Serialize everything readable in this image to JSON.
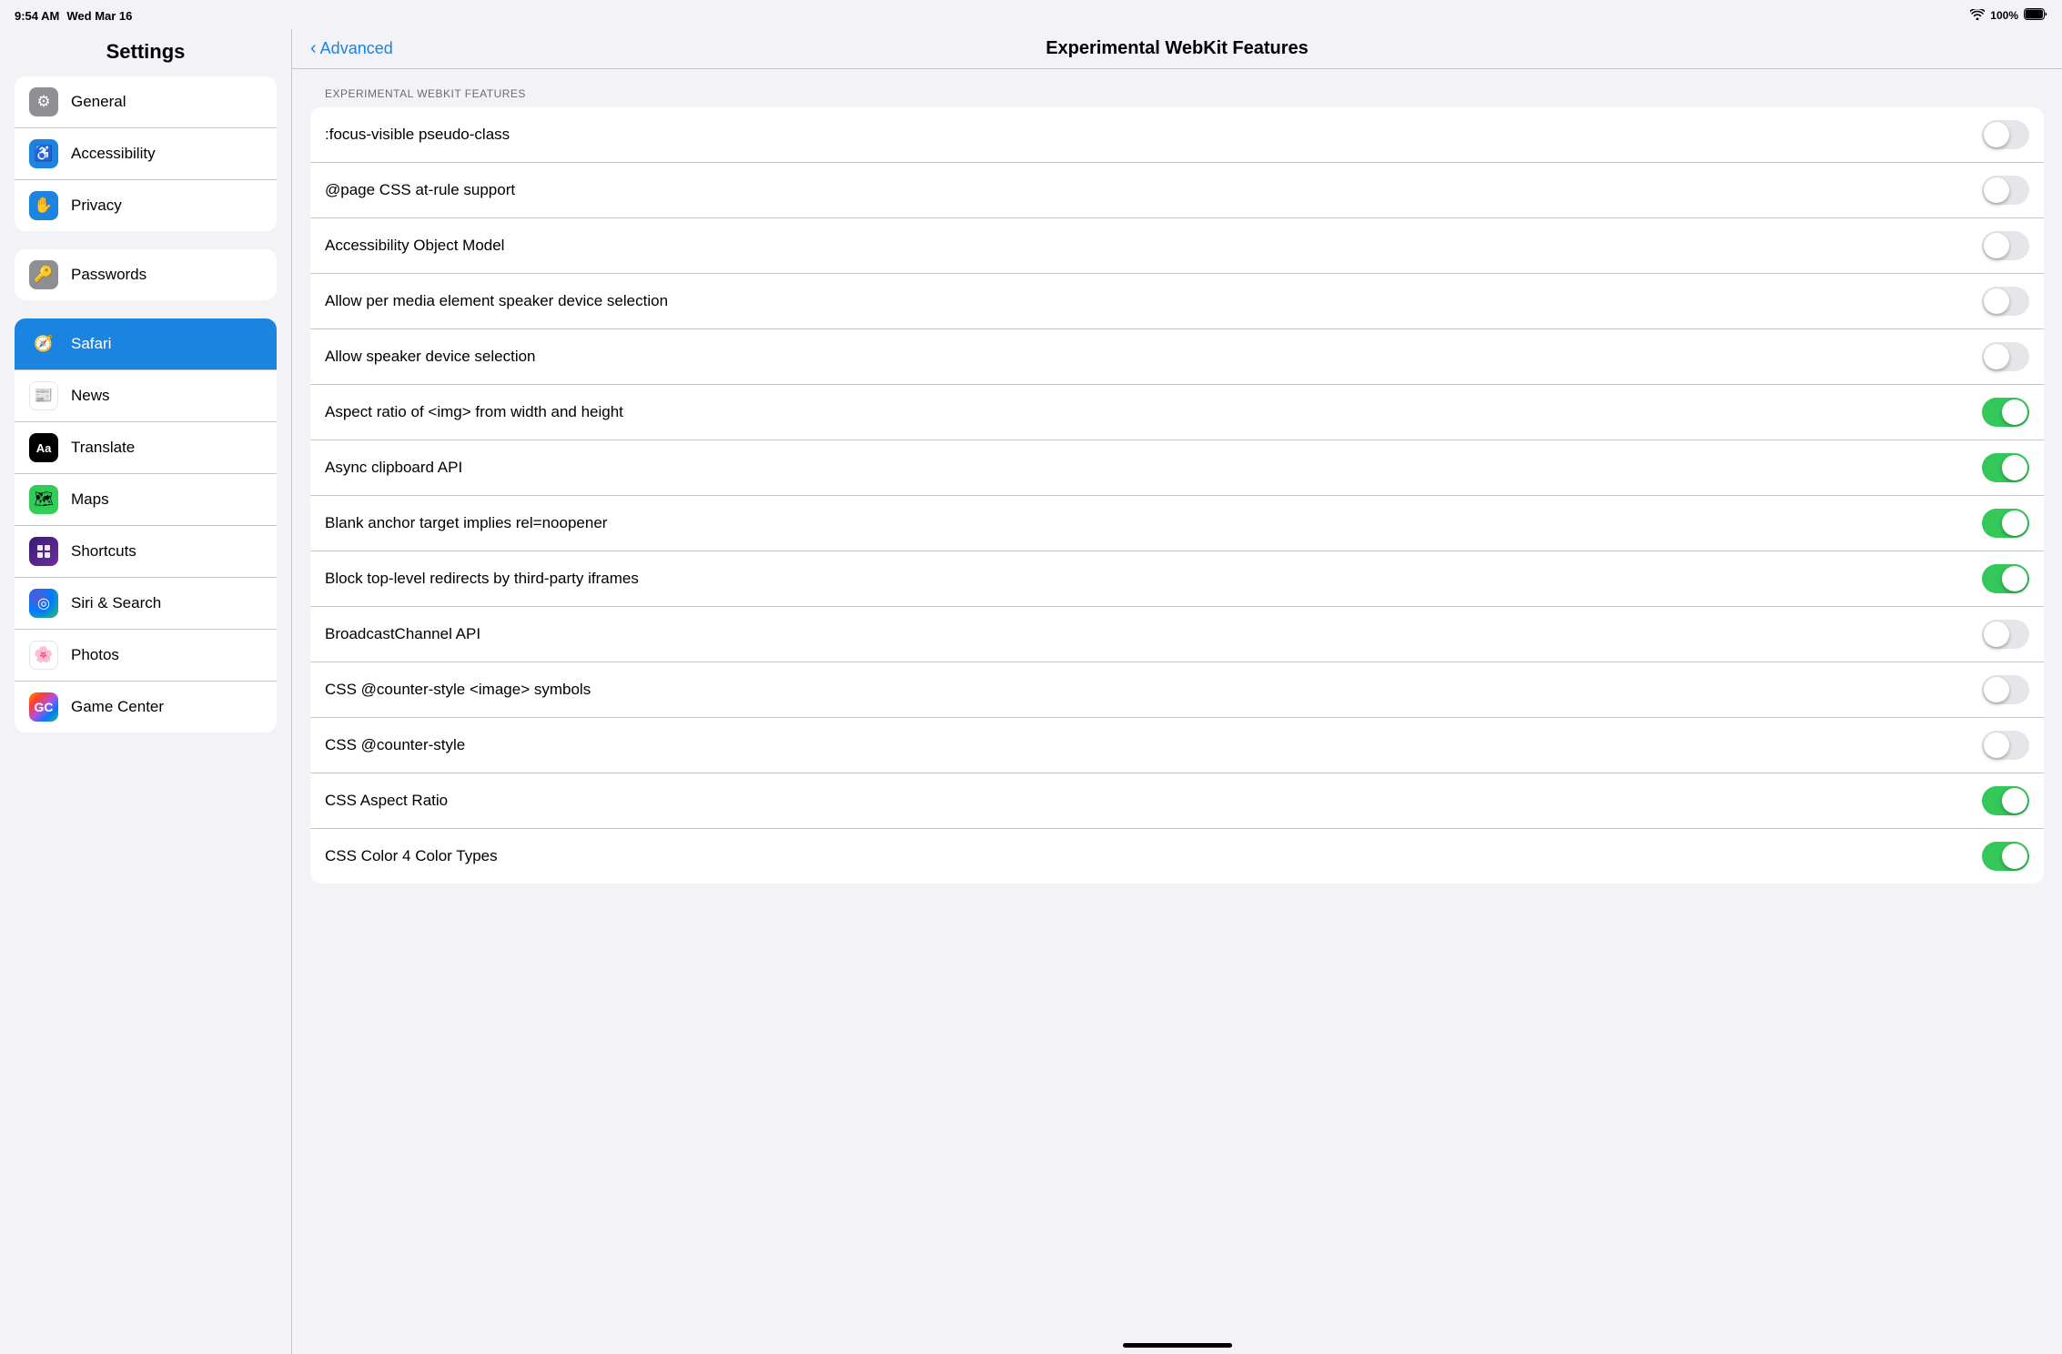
{
  "statusBar": {
    "time": "9:54 AM",
    "date": "Wed Mar 16",
    "battery": "100%"
  },
  "sidebar": {
    "title": "Settings",
    "groups": [
      {
        "id": "group1",
        "items": [
          {
            "id": "general",
            "label": "General",
            "iconType": "gray",
            "iconChar": "⚙️",
            "iconBg": "#8e8e93"
          },
          {
            "id": "accessibility",
            "label": "Accessibility",
            "iconType": "blue",
            "iconChar": "♿",
            "iconBg": "#1a84e0"
          },
          {
            "id": "privacy",
            "label": "Privacy",
            "iconType": "blue-hand",
            "iconChar": "✋",
            "iconBg": "#1a84e0"
          }
        ]
      },
      {
        "id": "group2",
        "items": [
          {
            "id": "passwords",
            "label": "Passwords",
            "iconType": "gray-key",
            "iconChar": "🔑",
            "iconBg": "#8e8e93"
          }
        ]
      },
      {
        "id": "group3",
        "items": [
          {
            "id": "safari",
            "label": "Safari",
            "iconType": "safari",
            "iconChar": "🧭",
            "iconBg": "#1a84e0",
            "active": true
          },
          {
            "id": "news",
            "label": "News",
            "iconType": "news",
            "iconChar": "📰",
            "iconBg": "#ff3b30"
          },
          {
            "id": "translate",
            "label": "Translate",
            "iconType": "translate",
            "iconChar": "Aa",
            "iconBg": "#000"
          },
          {
            "id": "maps",
            "label": "Maps",
            "iconType": "maps",
            "iconChar": "🗺",
            "iconBg": "#34c759"
          },
          {
            "id": "shortcuts",
            "label": "Shortcuts",
            "iconType": "shortcuts",
            "iconChar": "S",
            "iconBg": "#2c2c2e"
          },
          {
            "id": "siri",
            "label": "Siri & Search",
            "iconType": "siri",
            "iconChar": "◎",
            "iconBg": "#000"
          },
          {
            "id": "photos",
            "label": "Photos",
            "iconType": "photos",
            "iconChar": "🌸",
            "iconBg": "#fff"
          },
          {
            "id": "gamecenter",
            "label": "Game Center",
            "iconType": "gamecenter",
            "iconChar": "●",
            "iconBg": "#fff"
          }
        ]
      }
    ]
  },
  "rightPanel": {
    "backLabel": "Advanced",
    "pageTitle": "Experimental WebKit Features",
    "sectionHeader": "EXPERIMENTAL WEBKIT FEATURES",
    "features": [
      {
        "id": "focus-visible",
        "label": ":focus-visible pseudo-class",
        "enabled": false
      },
      {
        "id": "page-css",
        "label": "@page CSS at-rule support",
        "enabled": false
      },
      {
        "id": "accessibility-object",
        "label": "Accessibility Object Model",
        "enabled": false
      },
      {
        "id": "allow-per-media",
        "label": "Allow per media element speaker device selection",
        "enabled": false
      },
      {
        "id": "allow-speaker",
        "label": "Allow speaker device selection",
        "enabled": false
      },
      {
        "id": "aspect-ratio-img",
        "label": "Aspect ratio of <img> from width and height",
        "enabled": true
      },
      {
        "id": "async-clipboard",
        "label": "Async clipboard API",
        "enabled": true
      },
      {
        "id": "blank-anchor",
        "label": "Blank anchor target implies rel=noopener",
        "enabled": true
      },
      {
        "id": "block-redirects",
        "label": "Block top-level redirects by third-party iframes",
        "enabled": true
      },
      {
        "id": "broadcast-channel",
        "label": "BroadcastChannel API",
        "enabled": false
      },
      {
        "id": "css-counter-image",
        "label": "CSS @counter-style <image> symbols",
        "enabled": false
      },
      {
        "id": "css-counter",
        "label": "CSS @counter-style",
        "enabled": false
      },
      {
        "id": "css-aspect-ratio",
        "label": "CSS Aspect Ratio",
        "enabled": true
      },
      {
        "id": "css-color-4",
        "label": "CSS Color 4 Color Types",
        "enabled": true
      }
    ]
  }
}
